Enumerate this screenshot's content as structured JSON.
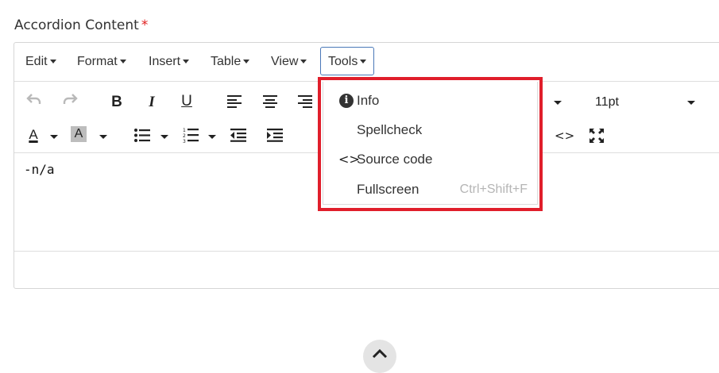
{
  "field": {
    "label": "Accordion Content",
    "required_mark": "*"
  },
  "menubar": {
    "items": [
      {
        "label": "Edit"
      },
      {
        "label": "Format"
      },
      {
        "label": "Insert"
      },
      {
        "label": "Table"
      },
      {
        "label": "View"
      },
      {
        "label": "Tools"
      }
    ]
  },
  "toolbar": {
    "font_size": "11pt",
    "bold": "B",
    "italic": "I",
    "underline": "U",
    "font_color": "A",
    "highlight": "A",
    "code": "<>"
  },
  "content": {
    "text": "-n/a"
  },
  "tools_menu": {
    "items": [
      {
        "icon": "info-icon",
        "label": "Info"
      },
      {
        "icon": "",
        "label": "Spellcheck"
      },
      {
        "icon": "code-icon",
        "label": "Source code"
      },
      {
        "icon": "",
        "label": "Fullscreen",
        "shortcut": "Ctrl+Shift+F"
      }
    ]
  },
  "colors": {
    "highlight_border": "#e01e2b",
    "required": "#e02020",
    "active_menu_border": "#4a78b8"
  }
}
